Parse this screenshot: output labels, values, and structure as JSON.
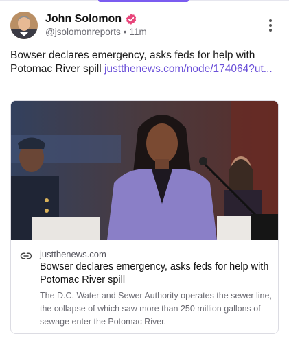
{
  "author": {
    "display_name": "John Solomon",
    "handle": "@jsolomonreports",
    "time_ago": "11m",
    "separator": "•",
    "verified_icon": "verified-badge-icon"
  },
  "post": {
    "text": "Bowser declares emergency, asks feds for help with Potomac River spill ",
    "link_text": "justthenews.com/node/174064?ut..."
  },
  "link_card": {
    "domain": "justthenews.com",
    "title": "Bowser declares emergency, asks feds for help with Potomac River spill",
    "description": "The D.C. Water and Sewer Authority operates the sewer line, the collapse of which saw more than 250 million gallons of sewage enter the Potomac River.",
    "image_alt": "Woman in purple suit speaking at a hearing with uniformed officer behind her"
  },
  "colors": {
    "accent": "#7b5cf0",
    "link": "#6a4fd8",
    "verified": "#e8457a"
  },
  "icons": {
    "more": "more-vertical-icon",
    "link": "link-icon"
  }
}
